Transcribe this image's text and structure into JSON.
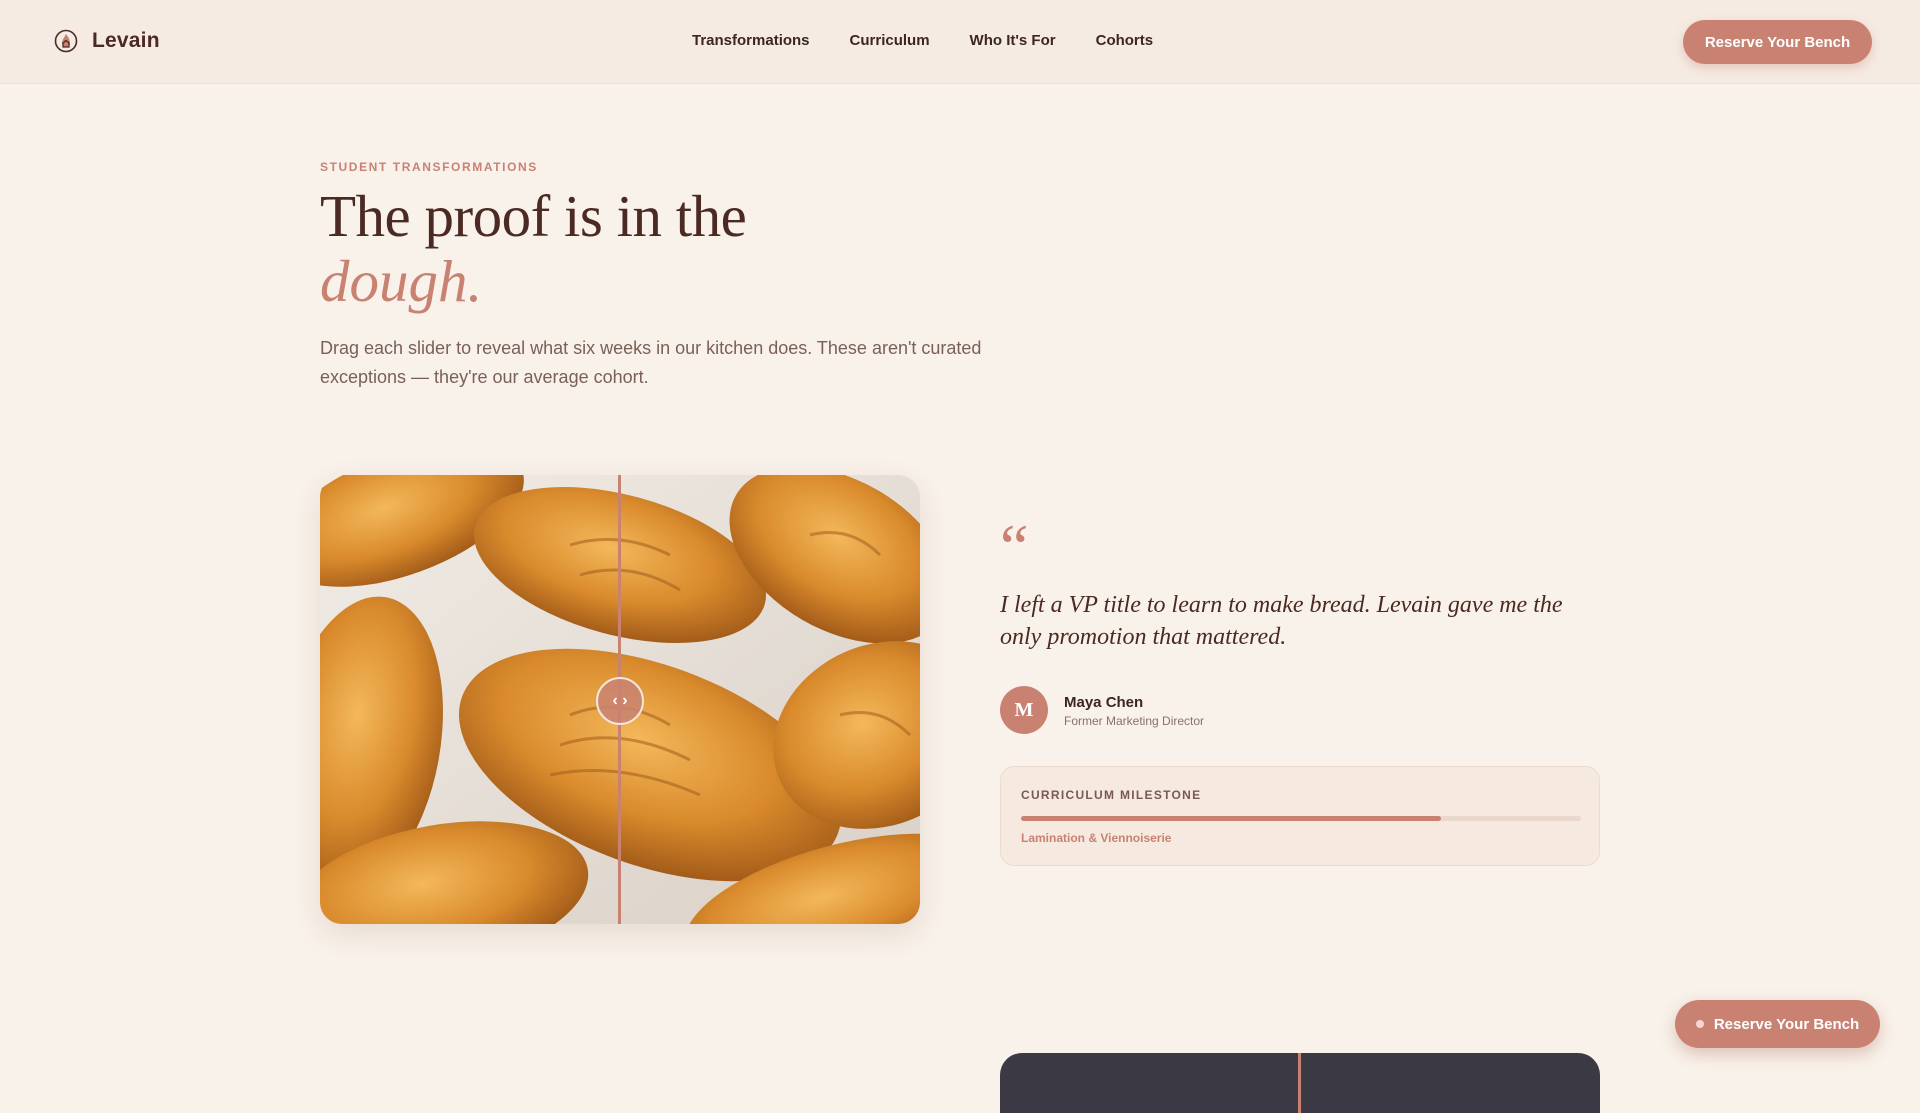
{
  "header": {
    "brand_name": "Levain",
    "brand_icon": "hearth-flame-icon",
    "nav": [
      "Transformations",
      "Curriculum",
      "Who It's For",
      "Cohorts"
    ],
    "cta_label": "Reserve Your Bench"
  },
  "hero": {
    "eyebrow": "STUDENT TRANSFORMATIONS",
    "headline": "The proof is in the",
    "headline_accent": "dough.",
    "lead": "Drag each slider to reveal what six weeks in our kitchen does. These aren't curated exceptions — they're our average cohort."
  },
  "compare": {
    "image": "croissants-photo",
    "handle_glyph": "‹ ›"
  },
  "testimonial": {
    "quote_mark": "“",
    "quote": "I left a VP title to learn to make bread. Levain gave me the only promotion that mattered.",
    "avatar_initial": "M",
    "author_name": "Maya Chen",
    "author_role": "Former Marketing Director"
  },
  "milestone": {
    "title": "CURRICULUM MILESTONE",
    "progress": 0.75,
    "label": "Lamination & Viennoiserie"
  },
  "floating_cta": {
    "label": "Reserve Your Bench"
  },
  "colors": {
    "accent": "#c98272",
    "background": "#f9f2ea",
    "text": "#4a2a22"
  }
}
